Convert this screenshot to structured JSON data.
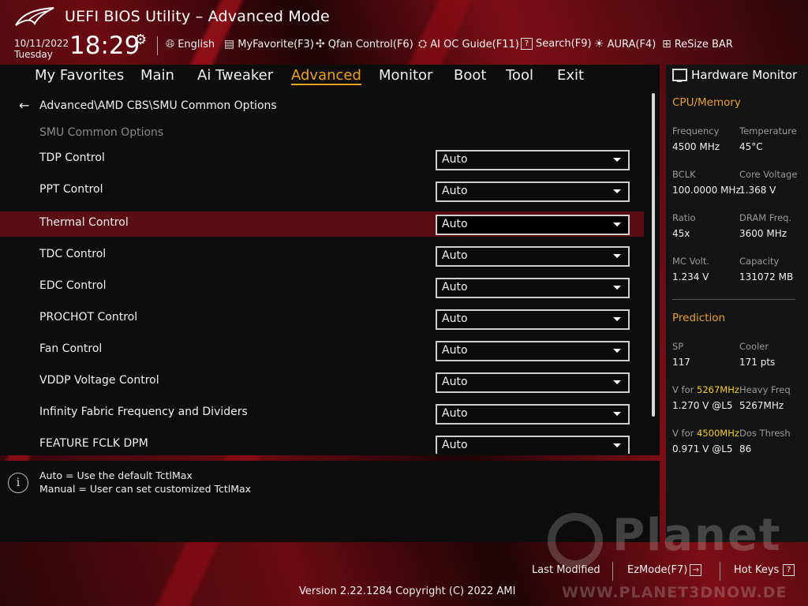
{
  "header": {
    "title": "UEFI BIOS Utility – Advanced Mode",
    "date": "10/11/2022",
    "weekday": "Tuesday",
    "time": "18:29",
    "toolbar": [
      {
        "label": "English",
        "icon": "globe-icon"
      },
      {
        "label": "MyFavorite(F3)",
        "icon": "favorite-icon"
      },
      {
        "label": "Qfan Control(F6)",
        "icon": "fan-icon"
      },
      {
        "label": "AI OC Guide(F11)",
        "icon": "ai-oc-icon"
      },
      {
        "label": "Search(F9)",
        "icon": "search-icon"
      },
      {
        "label": "AURA(F4)",
        "icon": "aura-icon"
      },
      {
        "label": "ReSize BAR",
        "icon": "resize-bar-icon"
      }
    ]
  },
  "menu": {
    "tabs": [
      {
        "label": "My Favorites"
      },
      {
        "label": "Main"
      },
      {
        "label": "Ai Tweaker"
      },
      {
        "label": "Advanced",
        "active": true
      },
      {
        "label": "Monitor"
      },
      {
        "label": "Boot"
      },
      {
        "label": "Tool"
      },
      {
        "label": "Exit"
      }
    ]
  },
  "content": {
    "breadcrumb": "Advanced\\AMD CBS\\SMU Common Options",
    "section_title": "SMU Common Options",
    "options": [
      {
        "label": "TDP Control",
        "value": "Auto"
      },
      {
        "label": "PPT Control",
        "value": "Auto"
      },
      {
        "label": "Thermal Control",
        "value": "Auto",
        "selected": true
      },
      {
        "label": "TDC Control",
        "value": "Auto"
      },
      {
        "label": "EDC Control",
        "value": "Auto"
      },
      {
        "label": "PROCHOT Control",
        "value": "Auto"
      },
      {
        "label": "Fan Control",
        "value": "Auto"
      },
      {
        "label": "VDDP Voltage Control",
        "value": "Auto"
      },
      {
        "label": "Infinity Fabric Frequency and Dividers",
        "value": "Auto"
      },
      {
        "label": "FEATURE FCLK DPM",
        "value": "Auto"
      }
    ]
  },
  "help": {
    "line1": "Auto = Use the default TctlMax",
    "line2": "Manual = User can set customized TctlMax"
  },
  "hardware_monitor": {
    "title": "Hardware Monitor",
    "cpu_memory": {
      "title": "CPU/Memory",
      "frequency_label": "Frequency",
      "frequency": "4500 MHz",
      "temperature_label": "Temperature",
      "temperature": "45°C",
      "bclk_label": "BCLK",
      "bclk": "100.0000 MHz",
      "core_voltage_label": "Core Voltage",
      "core_voltage": "1.368 V",
      "ratio_label": "Ratio",
      "ratio": "45x",
      "dram_freq_label": "DRAM Freq.",
      "dram_freq": "3600 MHz",
      "mc_volt_label": "MC Volt.",
      "mc_volt": "1.234 V",
      "capacity_label": "Capacity",
      "capacity": "131072 MB"
    },
    "prediction": {
      "title": "Prediction",
      "sp_label": "SP",
      "sp": "117",
      "cooler_label": "Cooler",
      "cooler": "171 pts",
      "v_for_label": "V for",
      "freq1": "5267MHz",
      "heavy_freq_label": "Heavy Freq",
      "v1": "1.270 V @L5",
      "heavy_freq": "5267MHz",
      "freq2": "4500MHz",
      "dos_thresh_label": "Dos Thresh",
      "v2": "0.971 V @L5",
      "dos_thresh": "86"
    }
  },
  "footer": {
    "last_modified": "Last Modified",
    "ezmode": "EzMode(F7)",
    "hotkeys": "Hot Keys",
    "hotkeys_key": "?",
    "version": "Version 2.22.1284 Copyright (C) 2022 AMI"
  },
  "watermark": {
    "name": "Planet",
    "url": "WWW.PLANET3DNOW.DE"
  },
  "colors": {
    "accent": "#f0a020",
    "selected_row": "#5a0d12",
    "highlight_freq": "#f0d020"
  }
}
